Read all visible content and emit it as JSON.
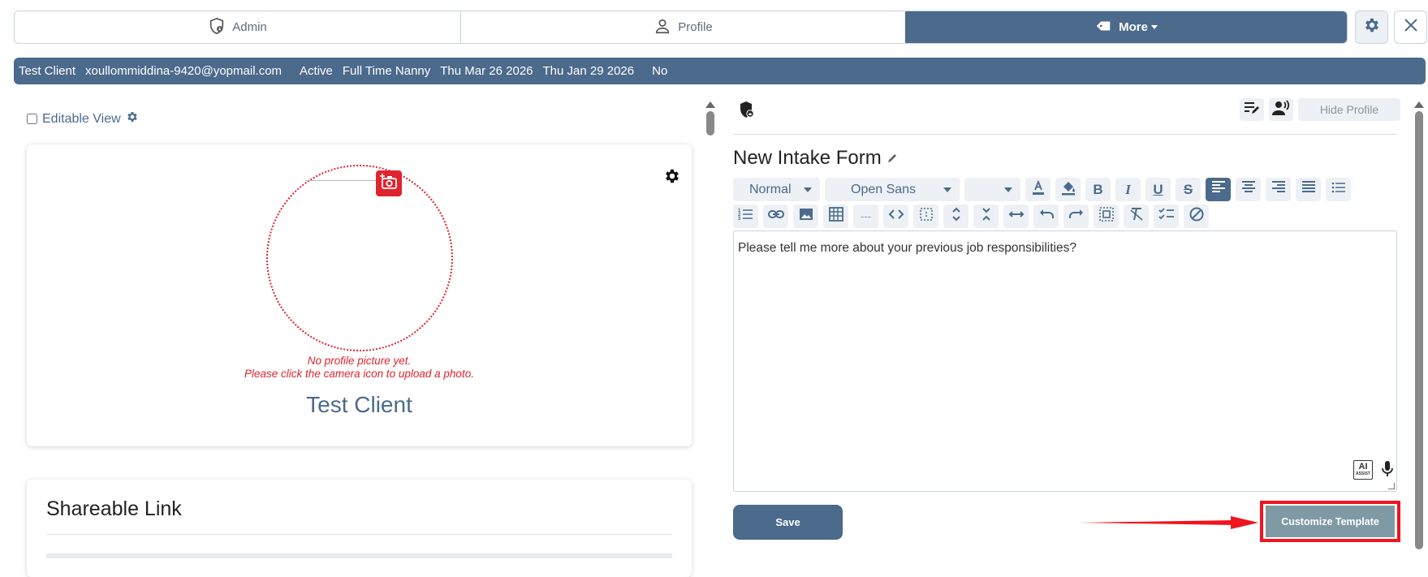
{
  "tabs": [
    {
      "label": "Admin",
      "icon": "shield-user-icon"
    },
    {
      "label": "Profile",
      "icon": "person-icon"
    },
    {
      "label": "More",
      "icon": "tag-icon"
    }
  ],
  "info_bar": {
    "name": "Test Client",
    "email": "xoullommiddina-9420@yopmail.com",
    "status": "Active",
    "position": "Full Time Nanny",
    "date1": "Thu Mar 26 2026",
    "date2": "Thu Jan 29 2026",
    "flag": "No"
  },
  "left": {
    "editable_view_label": "Editable View",
    "no_picture_line1": "No profile picture yet.",
    "no_picture_line2": "Please click the camera icon to upload a photo.",
    "client_name": "Test Client",
    "shareable_link_title": "Shareable Link"
  },
  "right": {
    "hide_profile_label": "Hide Profile",
    "form_title": "New Intake Form",
    "toolbar": {
      "style_select": "Normal",
      "font_select": "Open Sans",
      "size_select": "",
      "hr_label": "---"
    },
    "editor_text": "Please tell me more about your previous job responsibilities?",
    "ai_badge": "AI",
    "ai_badge_sub": "ASSIST",
    "save_label": "Save",
    "customize_label": "Customize Template"
  },
  "colors": {
    "primary": "#4b6a8c",
    "danger": "#e0242e",
    "highlight": "#f0141e",
    "customize_bg": "#7f9aa5",
    "toolbar_bg": "#edf1f5"
  }
}
